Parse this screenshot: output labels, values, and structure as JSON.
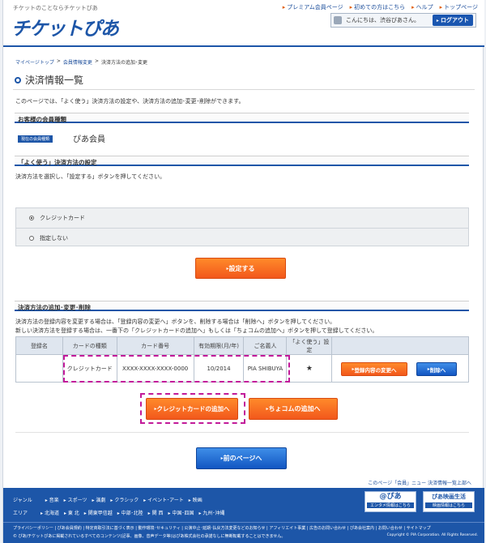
{
  "header": {
    "tagline": "チケットのことならチケットぴあ",
    "logo": "チケットぴあ",
    "topnav": [
      "プレミアム会員ページ",
      "初めての方はこちら",
      "ヘルプ",
      "トップページ"
    ],
    "greeting": "こんにちは、渋谷ぴあさん。",
    "logout": "ログアウト"
  },
  "breadcrumb": {
    "items": [
      "マイページトップ",
      "会員情報変更"
    ],
    "current": "決済方法の追加･変更",
    "sep": ">"
  },
  "page_title": "決済情報一覧",
  "intro": "このページでは、「よく使う」決済方法の設定や、決済方法の追加･変更･削除ができます。",
  "member_section": {
    "heading": "お客様の会員種類",
    "badge": "現在の会員種類",
    "type": "ぴあ会員"
  },
  "default_section": {
    "heading": "「よく使う」決済方法の設定",
    "instruction": "決済方法を選択し、「設定する」ボタンを押してください。",
    "options": [
      "クレジットカード",
      "指定しない"
    ],
    "selected": 0,
    "set_button": "設定する"
  },
  "manage_section": {
    "heading": "決済方法の追加･変更･削除",
    "explain1": "決済方法の登録内容を変更する場合は、「登録内容の変更へ」ボタンを、削除する場合は「削除へ」ボタンを押してください。",
    "explain2": "新しい決済方法を登録する場合は、一番下の「クレジットカードの追加へ」もしくは「ちょコムの追加へ」ボタンを押して登録してください。",
    "columns": [
      "登録名",
      "カードの種類",
      "カード番号",
      "有効期限(月/年)",
      "ご名義人",
      "「よく使う」設定",
      ""
    ],
    "row": {
      "name": "",
      "type": "クレジットカード",
      "number": "XXXX-XXXX-XXXX-0000",
      "expiry": "10/2014",
      "holder": "PIA SHIBUYA",
      "favorite": "★"
    },
    "edit_button": "登録内容の変更へ",
    "delete_button": "削除へ",
    "add_card_button": "クレジットカードの追加へ",
    "add_chocom_button": "ちょコムの追加へ"
  },
  "back_button": "前のページへ",
  "page_top": "このページ「会員」ニュー 決済情報一覧上部へ",
  "footer": {
    "genre_label": "ジャンル",
    "genres": [
      "音楽",
      "スポーツ",
      "演劇",
      "クラシック",
      "イベント･アート",
      "映画"
    ],
    "area_label": "エリア",
    "areas": [
      "北海道",
      "東 北",
      "関東甲信越",
      "中部･北陸",
      "関 西",
      "中国･四国",
      "九州･沖縄"
    ],
    "box1": {
      "title": "@ぴあ",
      "sub": "エンタメ情報はこちら"
    },
    "box2": {
      "title": "ぴあ映画生活",
      "sub": "映画情報はこちら"
    },
    "links": "プライバシーポリシー | ぴあ会員規約 | 特定商取引法に基づく表示 | 動作環境･セキュリティ | 公演中止･延期･払戻方法変更などのお知らせ | アフィリエイト事業 | 広告のお問い合わせ | ぴあ会社案内 | お問い合わせ | サイトマップ",
    "copyright": "© ぴあ/チケットぴあに掲載されているすべてのコンテンツ(記事、画像、音声データ等)はぴあ株式会社の承諾なしに無断転載することはできません。",
    "copyright2": "Copyright © PIA Corporation. All Rights Reserved."
  },
  "colors": {
    "brand": "#1d56a8",
    "orange": "#f2581c",
    "highlight": "#c21a9a"
  }
}
